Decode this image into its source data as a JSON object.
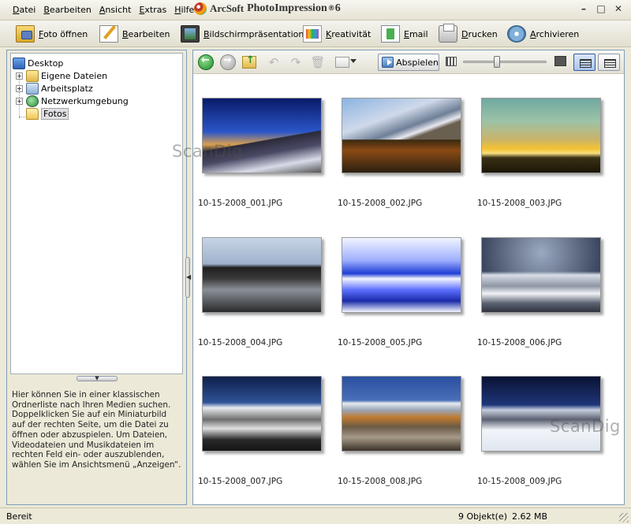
{
  "menu": [
    "Datei",
    "Bearbeiten",
    "Ansicht",
    "Extras",
    "Hilfe"
  ],
  "app_title": {
    "brand": "ArcSoft",
    "product": "PhotoImpression",
    "version": "6"
  },
  "window_controls": [
    "–",
    "□",
    "✕"
  ],
  "toolbar": {
    "open": "Foto öffnen",
    "edit": "Bearbeiten",
    "slideshow": "Bildschirmpräsentation",
    "creativity": "Kreativität",
    "email": "Email",
    "print": "Drucken",
    "archive": "Archivieren"
  },
  "tree": {
    "root": "Desktop",
    "items": [
      "Eigene Dateien",
      "Arbeitsplatz",
      "Netzwerkumgebung",
      "Fotos"
    ],
    "selected": "Fotos"
  },
  "help_text": "Hier können Sie in einer klassischen Ordnerliste nach Ihren Medien suchen. Doppelklicken Sie auf ein Miniaturbild auf der rechten Seite, um die Datei zu öffnen oder abzuspielen. Um Dateien, Videodateien und Musikdateien im rechten Feld ein- oder auszublenden, wählen Sie im Ansichtsmenü „Anzeigen“.",
  "right_toolbar": {
    "play_label": "Abspielen",
    "zoom_level": 0.4
  },
  "thumbnails": [
    "10-15-2008_001.JPG",
    "10-15-2008_002.JPG",
    "10-15-2008_003.JPG",
    "10-15-2008_004.JPG",
    "10-15-2008_005.JPG",
    "10-15-2008_006.JPG",
    "10-15-2008_007.JPG",
    "10-15-2008_008.JPG",
    "10-15-2008_009.JPG"
  ],
  "watermark": "ScanDig",
  "status": {
    "left": "Bereit",
    "count": "9 Objekt(e)",
    "size": "2.62 MB"
  }
}
